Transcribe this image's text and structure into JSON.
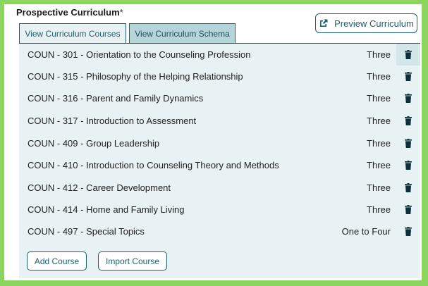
{
  "section": {
    "title": "Prospective Curriculum",
    "required_marker": "*"
  },
  "preview_button": {
    "label": "Preview Curriculum",
    "icon": "external-link-icon"
  },
  "tabs": [
    {
      "label": "View Curriculum Courses",
      "active": true
    },
    {
      "label": "View Curriculum Schema",
      "active": false
    }
  ],
  "courses": [
    {
      "name": "COUN - 301 - Orientation to the Counseling Profession",
      "credits": "Three"
    },
    {
      "name": "COUN - 315 - Philosophy of the Helping Relationship",
      "credits": "Three"
    },
    {
      "name": "COUN - 316 - Parent and Family Dynamics",
      "credits": "Three"
    },
    {
      "name": "COUN - 317 - Introduction to Assessment",
      "credits": "Three"
    },
    {
      "name": "COUN - 409 - Group Leadership",
      "credits": "Three"
    },
    {
      "name": "COUN - 410 - Introduction to Counseling Theory and Methods",
      "credits": "Three"
    },
    {
      "name": "COUN - 412 - Career Development",
      "credits": "Three"
    },
    {
      "name": "COUN - 414 - Home and Family Living",
      "credits": "Three"
    },
    {
      "name": "COUN - 497 - Special Topics",
      "credits": "One to Four"
    }
  ],
  "actions": {
    "add_label": "Add Course",
    "import_label": "Import Course"
  },
  "colors": {
    "frame": "#8bd45e",
    "accent": "#1f5f6e",
    "panel": "#e8f1f3",
    "inactive_tab": "#b6d5da"
  }
}
